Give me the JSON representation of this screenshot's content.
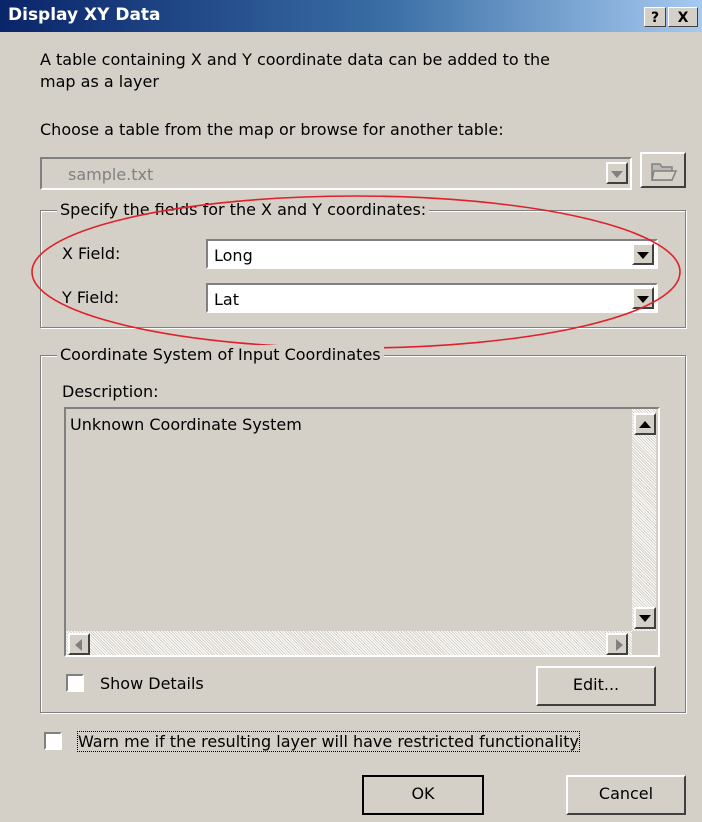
{
  "window": {
    "title": "Display XY Data",
    "help_btn": "?",
    "close_btn": "X"
  },
  "intro": {
    "line1": "A table containing X and Y coordinate data can be added to the",
    "line2": "map as a layer"
  },
  "table_prompt": "Choose a table from the map or browse for another table:",
  "table_combo": {
    "value": "sample.txt"
  },
  "fields_group": {
    "legend": "Specify the fields for the X and Y coordinates:",
    "x_label": "X Field:",
    "x_value": "Long",
    "y_label": "Y Field:",
    "y_value": "Lat"
  },
  "coord_group": {
    "legend": "Coordinate System of Input Coordinates",
    "description_label": "Description:",
    "description_text": "Unknown Coordinate System",
    "show_details": "Show Details",
    "edit": "Edit..."
  },
  "warn_checkbox": "Warn me if the resulting layer will have restricted functionality",
  "buttons": {
    "ok": "OK",
    "cancel": "Cancel"
  },
  "colors": {
    "titlebar_start": "#0a246a",
    "titlebar_end": "#a6caf0",
    "annotation": "#e0202a",
    "face": "#d4d0c8"
  }
}
